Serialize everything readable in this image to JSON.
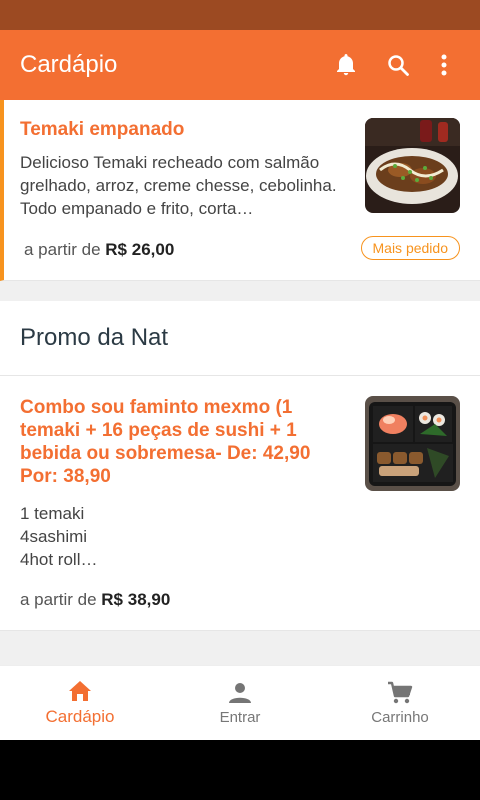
{
  "appbar": {
    "title": "Cardápio"
  },
  "colors": {
    "primary": "#f36f32",
    "accent": "#f7931e",
    "statusbar": "#9c4a22"
  },
  "items": [
    {
      "name": "Temaki empanado",
      "description": "Delicioso Temaki recheado com salmão grelhado, arroz, creme chesse, cebolinha. Todo empanado e frito, corta…",
      "price_prefix": "a partir de",
      "price": "R$ 26,00",
      "badge": "Mais pedido",
      "image_icon": "temaki-food-photo"
    }
  ],
  "section": {
    "title": "Promo da Nat"
  },
  "promo_items": [
    {
      "name": "Combo sou faminto mexmo (1 temaki + 16 peças de sushi + 1 bebida ou sobremesa- De: 42,90 Por: 38,90",
      "description_lines": [
        "1 temaki",
        "4sashimi",
        "4hot roll…"
      ],
      "price_prefix": "a partir de",
      "price": "R$ 38,90",
      "image_icon": "sushi-combo-photo"
    }
  ],
  "bottom_nav": [
    {
      "label": "Cardápio",
      "icon": "home-icon",
      "active": true
    },
    {
      "label": "Entrar",
      "icon": "person-icon",
      "active": false
    },
    {
      "label": "Carrinho",
      "icon": "cart-icon",
      "active": false
    }
  ]
}
